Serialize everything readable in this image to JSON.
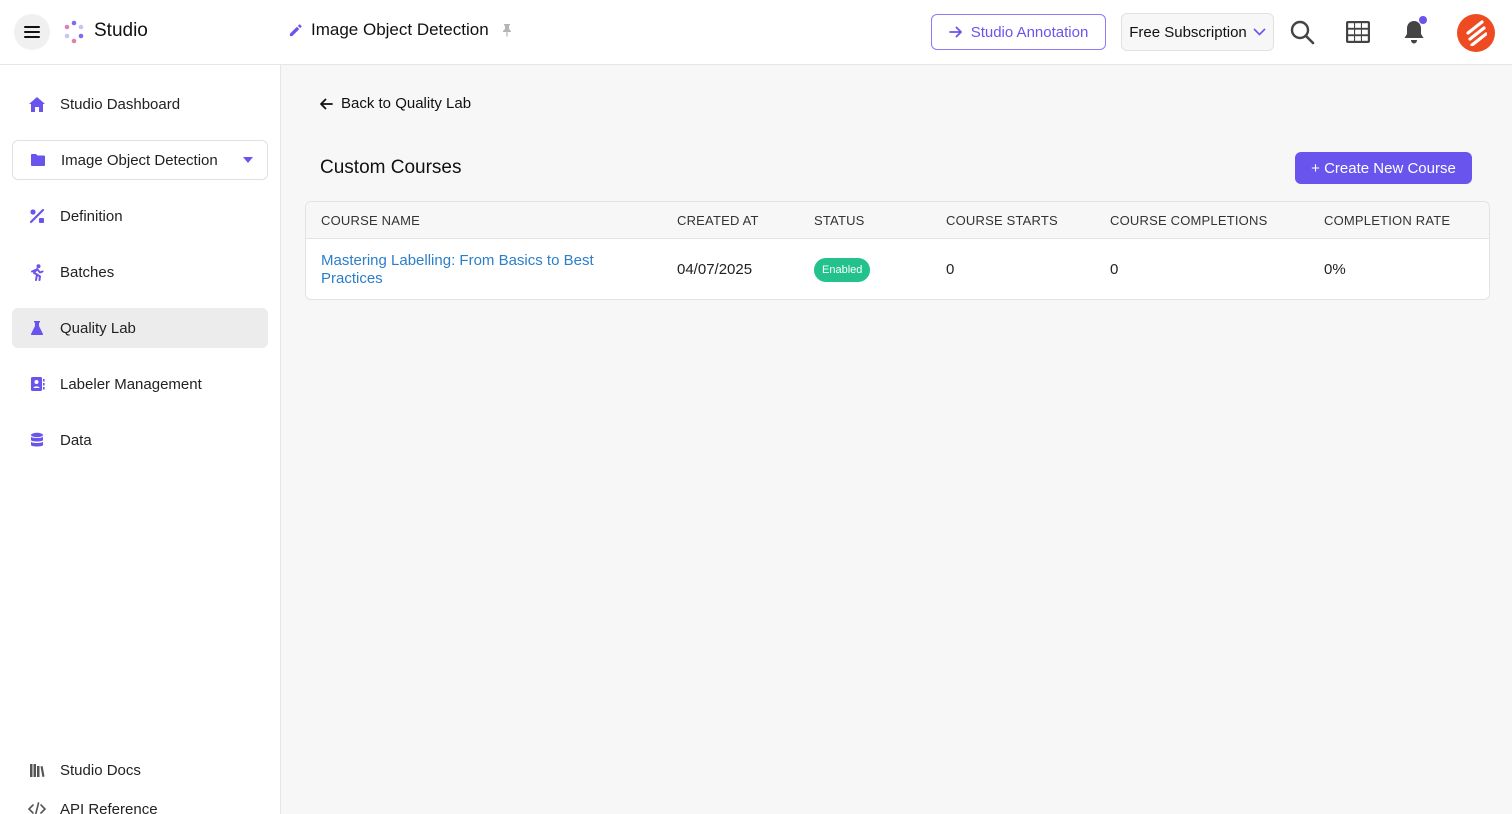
{
  "header": {
    "app_title": "Studio",
    "project_title": "Image Object Detection",
    "annotation_button": "Studio Annotation",
    "subscription": "Free Subscription"
  },
  "sidebar": {
    "items": [
      {
        "label": "Studio Dashboard",
        "icon": "home-icon"
      },
      {
        "label": "Image Object Detection",
        "icon": "folder-icon"
      },
      {
        "label": "Definition",
        "icon": "definition-icon"
      },
      {
        "label": "Batches",
        "icon": "runner-icon"
      },
      {
        "label": "Quality Lab",
        "icon": "flask-icon"
      },
      {
        "label": "Labeler Management",
        "icon": "contact-book-icon"
      },
      {
        "label": "Data",
        "icon": "database-icon"
      }
    ],
    "bottom": [
      {
        "label": "Studio Docs",
        "icon": "library-icon"
      },
      {
        "label": "API Reference",
        "icon": "code-icon"
      }
    ]
  },
  "main": {
    "back_link": "Back to Quality Lab",
    "section_title": "Custom Courses",
    "create_button": "+ Create New Course",
    "table": {
      "headers": [
        "COURSE NAME",
        "CREATED AT",
        "STATUS",
        "COURSE STARTS",
        "COURSE COMPLETIONS",
        "COMPLETION RATE"
      ],
      "rows": [
        {
          "course_name": "Mastering Labelling: From Basics to Best Practices",
          "created_at": "04/07/2025",
          "status": "Enabled",
          "course_starts": "0",
          "course_completions": "0",
          "completion_rate": "0%"
        }
      ]
    }
  },
  "colors": {
    "accent": "#6a54ee",
    "link": "#2b7fc9",
    "status_enabled": "#23c18c",
    "avatar": "#ee4b22"
  }
}
